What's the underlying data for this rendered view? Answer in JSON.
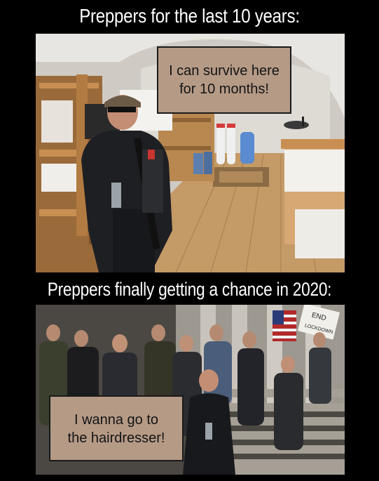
{
  "captions": {
    "top": "Preppers for the last 10 years:",
    "middle": "Preppers finally getting a chance in 2020:"
  },
  "bubbles": {
    "top": {
      "line1": "I can survive here",
      "line2": "for 10 months!"
    },
    "bottom": {
      "line1": "I wanna go to",
      "line2": "the hairdresser!"
    }
  },
  "signs": {
    "end": "END",
    "lockdown": "LOCKDOWN"
  },
  "colors": {
    "background": "#000000",
    "bubble": "#b59a86",
    "caption_text": "#ffffff"
  }
}
